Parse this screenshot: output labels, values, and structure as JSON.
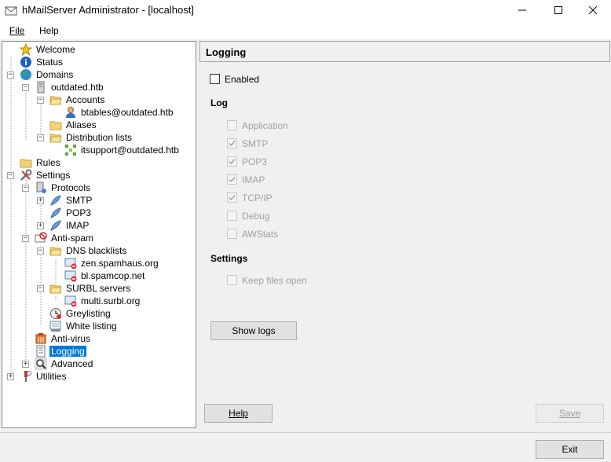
{
  "window": {
    "title": "hMailServer Administrator - [localhost]",
    "minimize_glyph": "—",
    "maximize_glyph": "☐",
    "close_glyph": "✕"
  },
  "menu": {
    "file": "File",
    "help": "Help"
  },
  "tree": {
    "welcome": "Welcome",
    "status": "Status",
    "domains": "Domains",
    "domain": "outdated.htb",
    "accounts": "Accounts",
    "account1": "btables@outdated.htb",
    "aliases": "Aliases",
    "distribution_lists": "Distribution lists",
    "dl1": "itsupport@outdated.htb",
    "rules": "Rules",
    "settings": "Settings",
    "protocols": "Protocols",
    "smtp": "SMTP",
    "pop3": "POP3",
    "imap": "IMAP",
    "antispam": "Anti-spam",
    "dns_blacklists": "DNS blacklists",
    "dnsbl1": "zen.spamhaus.org",
    "dnsbl2": "bl.spamcop.net",
    "surbl_servers": "SURBL servers",
    "surbl1": "multi.surbl.org",
    "greylisting": "Greylisting",
    "white_listing": "White listing",
    "antivirus": "Anti-virus",
    "logging": "Logging",
    "advanced": "Advanced",
    "utilities": "Utilities",
    "expand_glyph": "+",
    "collapse_glyph": "−"
  },
  "panel": {
    "title": "Logging",
    "enabled_label": "Enabled",
    "enabled_checked": false,
    "log_section": "Log",
    "log_options": [
      {
        "label": "Application",
        "checked": false
      },
      {
        "label": "SMTP",
        "checked": true
      },
      {
        "label": "POP3",
        "checked": true
      },
      {
        "label": "IMAP",
        "checked": true
      },
      {
        "label": "TCP/IP",
        "checked": true
      },
      {
        "label": "Debug",
        "checked": false
      },
      {
        "label": "AWStats",
        "checked": false
      }
    ],
    "settings_section": "Settings",
    "keep_files_open": "Keep files open",
    "show_logs": "Show logs"
  },
  "footer": {
    "help": "Help",
    "save": "Save",
    "exit": "Exit"
  }
}
